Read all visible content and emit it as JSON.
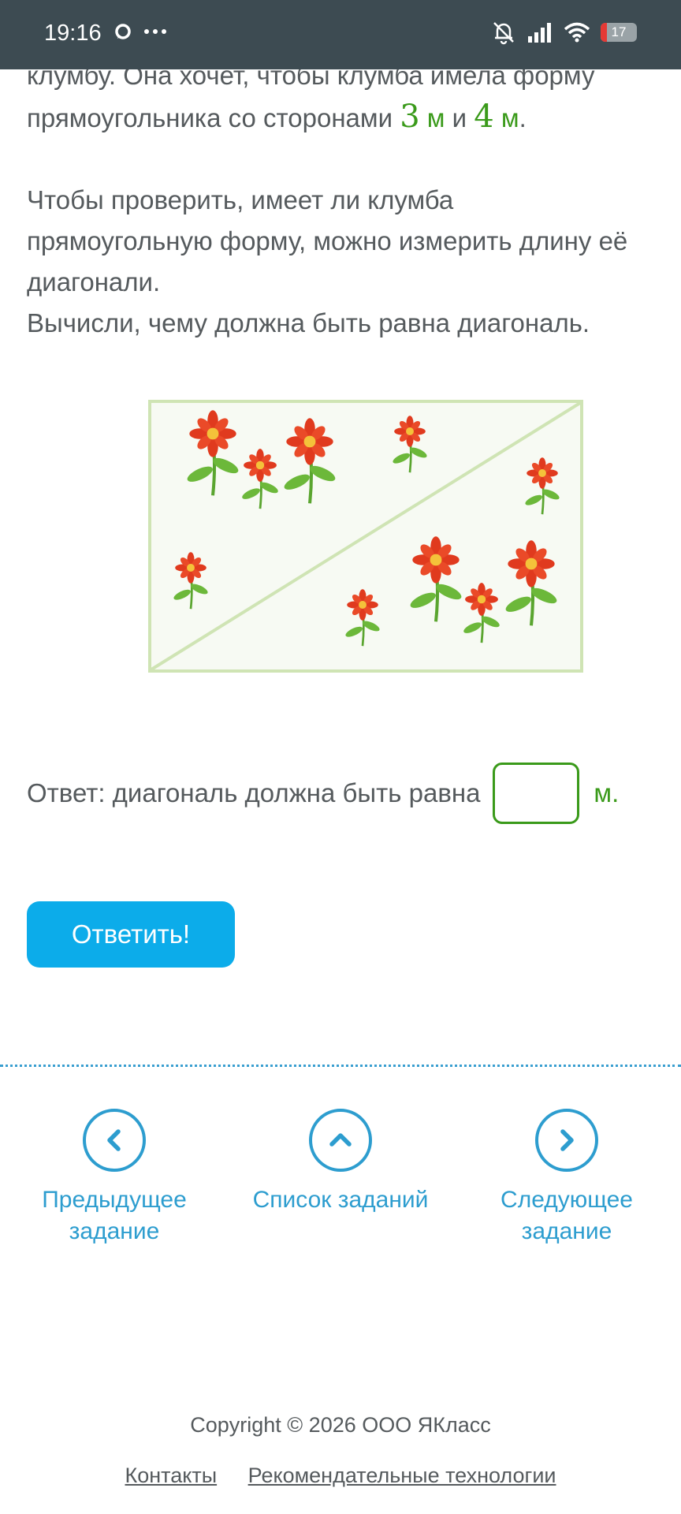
{
  "status_bar": {
    "time": "19:16",
    "battery": "17"
  },
  "task": {
    "line1": "клумбу. Она хочет, чтобы клумба имела форму",
    "line2_prefix": "прямоугольника со сторонами ",
    "side_a": "3",
    "unit_a": " м",
    "conj": " и ",
    "side_b": "4",
    "unit_b": " м",
    "period": ".",
    "para2_line1": "Чтобы проверить, имеет ли клумба",
    "para2_line2": "прямоугольную форму, можно измерить длину её",
    "para2_line3": "диагонали.",
    "para2_line4": "Вычисли, чему должна быть равна диагональ."
  },
  "answer": {
    "label": "Ответ: диагональ должна быть равна",
    "value": "",
    "unit": "м."
  },
  "submit_label": "Ответить!",
  "nav": {
    "prev_line1": "Предыдущее",
    "prev_line2": "задание",
    "list": "Список заданий",
    "next_line1": "Следующее",
    "next_line2": "задание"
  },
  "footer": {
    "copyright": "Copyright © 2026 ООО ЯКласс",
    "contacts": "Контакты",
    "recommend": "Рекомендательные технологии"
  },
  "colors": {
    "accent": "#0cacea",
    "green": "#3a9a1a",
    "link": "#2d9dcf",
    "statusbar": "#3d4b52"
  }
}
